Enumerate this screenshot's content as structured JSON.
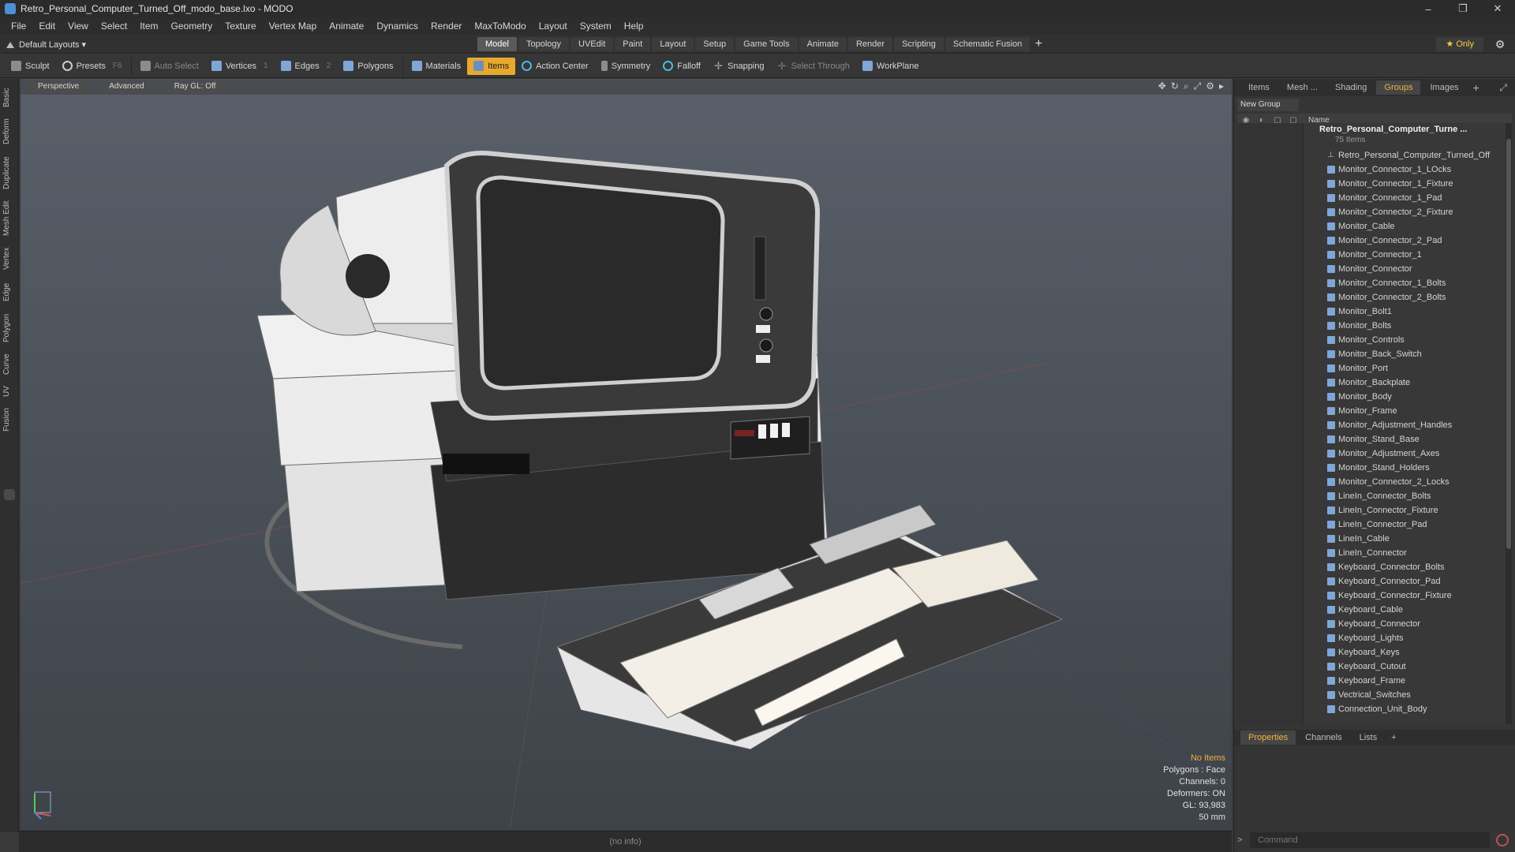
{
  "window": {
    "title": "Retro_Personal_Computer_Turned_Off_modo_base.lxo - MODO",
    "controls": [
      "–",
      "❐",
      "✕"
    ]
  },
  "menu": [
    "File",
    "Edit",
    "View",
    "Select",
    "Item",
    "Geometry",
    "Texture",
    "Vertex Map",
    "Animate",
    "Dynamics",
    "Render",
    "MaxToModo",
    "Layout",
    "System",
    "Help"
  ],
  "layout_dropdown": "Default Layouts ▾",
  "mode_tabs": [
    "Model",
    "Topology",
    "UVEdit",
    "Paint",
    "Layout",
    "Setup",
    "Game Tools",
    "Animate",
    "Render",
    "Scripting",
    "Schematic Fusion"
  ],
  "active_mode_tab": "Model",
  "only_label": "★  Only",
  "toolbar": {
    "sculpt": "Sculpt",
    "presets": "Presets",
    "presets_hint": "F6",
    "auto_select": "Auto Select",
    "vertices": "Vertices",
    "vertices_count": "1",
    "edges": "Edges",
    "edges_count": "2",
    "polygons": "Polygons",
    "materials": "Materials",
    "items": "Items",
    "action_center": "Action Center",
    "symmetry": "Symmetry",
    "falloff": "Falloff",
    "snapping": "Snapping",
    "select_through": "Select Through",
    "workplane": "WorkPlane"
  },
  "left_tabs": [
    "Basic",
    "Deform",
    "Duplicate",
    "Mesh Edit",
    "Vertex",
    "Edge",
    "Polygon",
    "Curve",
    "UV",
    "Fusion"
  ],
  "viewport": {
    "view_mode": "Perspective",
    "shading": "Advanced",
    "raygl": "Ray GL: Off",
    "info": {
      "selection": "No Items",
      "polygons": "Polygons : Face",
      "channels": "Channels: 0",
      "deformers": "Deformers: ON",
      "gl": "GL: 93,983",
      "scale": "50 mm"
    }
  },
  "status_text": "(no info)",
  "right_panel": {
    "tabs": [
      "Items",
      "Mesh ...",
      "Shading",
      "Groups",
      "Images"
    ],
    "active_tab": "Groups",
    "new_group": "New Group",
    "column_name": "Name",
    "group_name": "Retro_Personal_Computer_Turne ...",
    "group_count": "75 Items",
    "items": [
      "Retro_Personal_Computer_Turned_Off",
      "Monitor_Connector_1_LOcks",
      "Monitor_Connector_1_Fixture",
      "Monitor_Connector_1_Pad",
      "Monitor_Connector_2_Fixture",
      "Monitor_Cable",
      "Monitor_Connector_2_Pad",
      "Monitor_Connector_1",
      "Monitor_Connector",
      "Monitor_Connector_1_Bolts",
      "Monitor_Connector_2_Bolts",
      "Monitor_Bolt1",
      "Monitor_Bolts",
      "Monitor_Controls",
      "Monitor_Back_Switch",
      "Monitor_Port",
      "Monitor_Backplate",
      "Monitor_Body",
      "Monitor_Frame",
      "Monitor_Adjustment_Handles",
      "Monitor_Stand_Base",
      "Monitor_Adjustment_Axes",
      "Monitor_Stand_Holders",
      "Monitor_Connector_2_Locks",
      "LineIn_Connector_Bolts",
      "LineIn_Connector_Fixture",
      "LineIn_Connector_Pad",
      "LineIn_Cable",
      "LineIn_Connector",
      "Keyboard_Connector_Bolts",
      "Keyboard_Connector_Pad",
      "Keyboard_Connector_Fixture",
      "Keyboard_Cable",
      "Keyboard_Connector",
      "Keyboard_Lights",
      "Keyboard_Keys",
      "Keyboard_Cutout",
      "Keyboard_Frame",
      "Vectrical_Switches",
      "Connection_Unit_Body"
    ],
    "props_tabs": [
      "Properties",
      "Channels",
      "Lists"
    ],
    "active_props_tab": "Properties",
    "command_placeholder": "Command",
    "command_prompt": ">"
  },
  "colors": {
    "accent": "#e8a92e",
    "highlight_text": "#f1b33a",
    "mesh_icon": "#7fa6d6"
  }
}
